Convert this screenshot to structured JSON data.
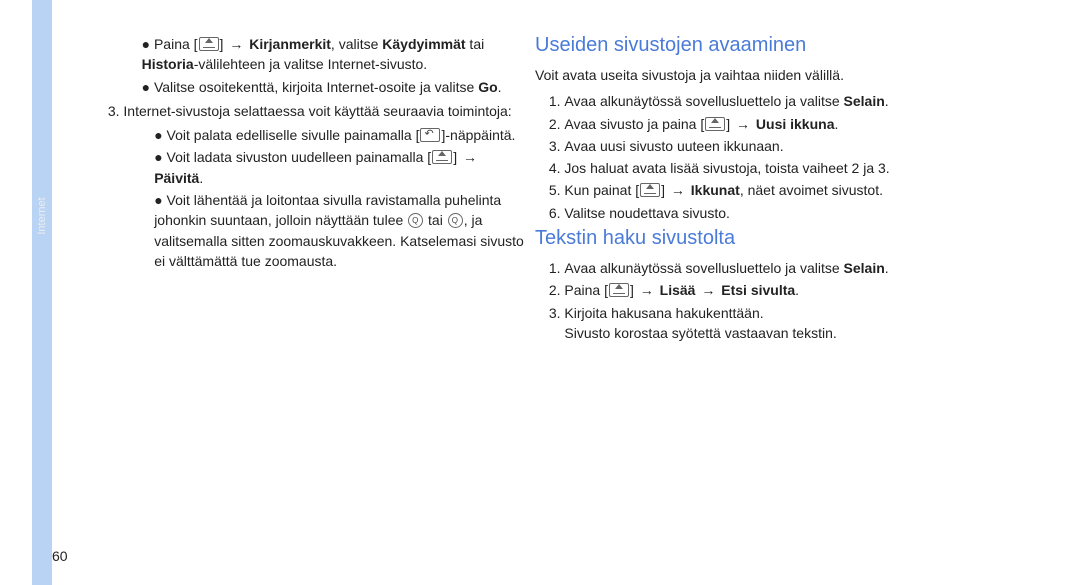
{
  "sidebar": {
    "label": "Internet"
  },
  "page_number": "60",
  "arrow": "→",
  "left": {
    "bullet1a": "Paina [",
    "bullet1b": "] ",
    "bullet1c": "Kirjanmerkit",
    "bullet1d": ", valitse ",
    "bullet1e": "Käydyimmät",
    "bullet1f": " tai ",
    "bullet1g": "Historia",
    "bullet1h": "-välilehteen ja valitse Internet-sivusto.",
    "bullet2a": "Valitse osoitekenttä, kirjoita Internet-osoite ja valitse ",
    "bullet2b": "Go",
    "bullet2c": ".",
    "step3": "Internet-sivustoja selattaessa voit käyttää seuraavia toimintoja:",
    "sb1a": "Voit palata edelliselle sivulle painamalla [",
    "sb1b": "]-näppäintä.",
    "sb2a": "Voit ladata sivuston uudelleen painamalla [",
    "sb2b": "] ",
    "sb2c": "Päivitä",
    "sb2d": ".",
    "sb3a": "Voit lähentää ja loitontaa sivulla ravistamalla puhelinta johonkin suuntaan, jolloin näyttään tulee ",
    "sb3b": " tai ",
    "sb3c": ", ja valitsemalla sitten zoomauskuvakkeen. Katselemasi sivusto ei välttämättä tue zoomausta."
  },
  "right": {
    "h1": "Useiden sivustojen avaaminen",
    "intro": "Voit avata useita sivustoja ja vaihtaa niiden välillä.",
    "r1a": "Avaa alkunäytössä sovellusluettelo ja valitse ",
    "r1b": "Selain",
    "r1c": ".",
    "r2a": "Avaa sivusto ja paina [",
    "r2b": "] ",
    "r2c": "Uusi ikkuna",
    "r2d": ".",
    "r3": "Avaa uusi sivusto uuteen ikkunaan.",
    "r4": "Jos haluat avata lisää sivustoja, toista vaiheet 2 ja 3.",
    "r5a": "Kun painat [",
    "r5b": "] ",
    "r5c": "Ikkunat",
    "r5d": ", näet avoimet sivustot.",
    "r6": "Valitse noudettava sivusto.",
    "h2": "Tekstin haku sivustolta",
    "t1a": "Avaa alkunäytössä sovellusluettelo ja valitse ",
    "t1b": "Selain",
    "t1c": ".",
    "t2a": "Paina [",
    "t2b": "] ",
    "t2c": "Lisää",
    "t2d": "Etsi sivulta",
    "t2e": ".",
    "t3a": "Kirjoita hakusana hakukenttään.",
    "t3b": "Sivusto korostaa syötettä vastaavan tekstin."
  }
}
